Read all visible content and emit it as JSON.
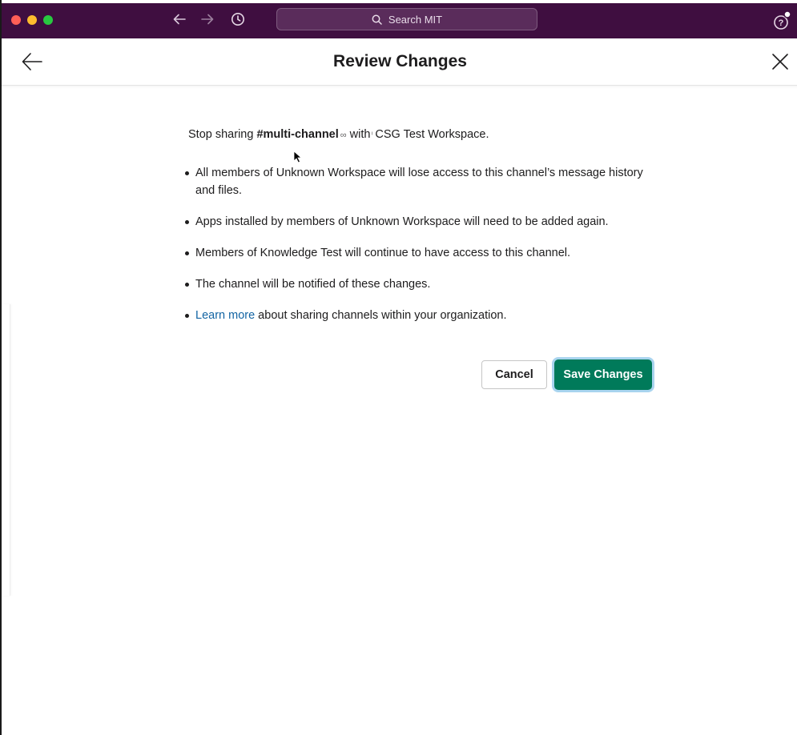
{
  "app": {
    "search_placeholder": "Search MIT"
  },
  "header": {
    "title": "Review Changes"
  },
  "content": {
    "intro_prefix": "Stop sharing ",
    "channel_name": "#multi-channel",
    "intro_with": "with",
    "workspace_name": "CSG Test Workspace.",
    "bullets": [
      "All members of Unknown Workspace will lose access to this channel’s message history and files.",
      "Apps installed by members of Unknown Workspace will need to be added again.",
      "Members of Knowledge Test will continue to have access to this channel.",
      "The channel will be notified of these changes."
    ],
    "learn_more_link": "Learn more",
    "learn_more_suffix": " about sharing channels within your organization."
  },
  "actions": {
    "cancel_label": "Cancel",
    "save_label": "Save Changes"
  },
  "colors": {
    "titlebar": "#3f0e40",
    "primary_button": "#007a5a",
    "link": "#1264a3"
  },
  "icons": {
    "back": "arrow-left-icon",
    "forward": "arrow-right-icon",
    "history": "clock-icon",
    "search": "search-icon",
    "help": "help-icon",
    "close": "close-icon",
    "shared_channel": "link-icon"
  }
}
